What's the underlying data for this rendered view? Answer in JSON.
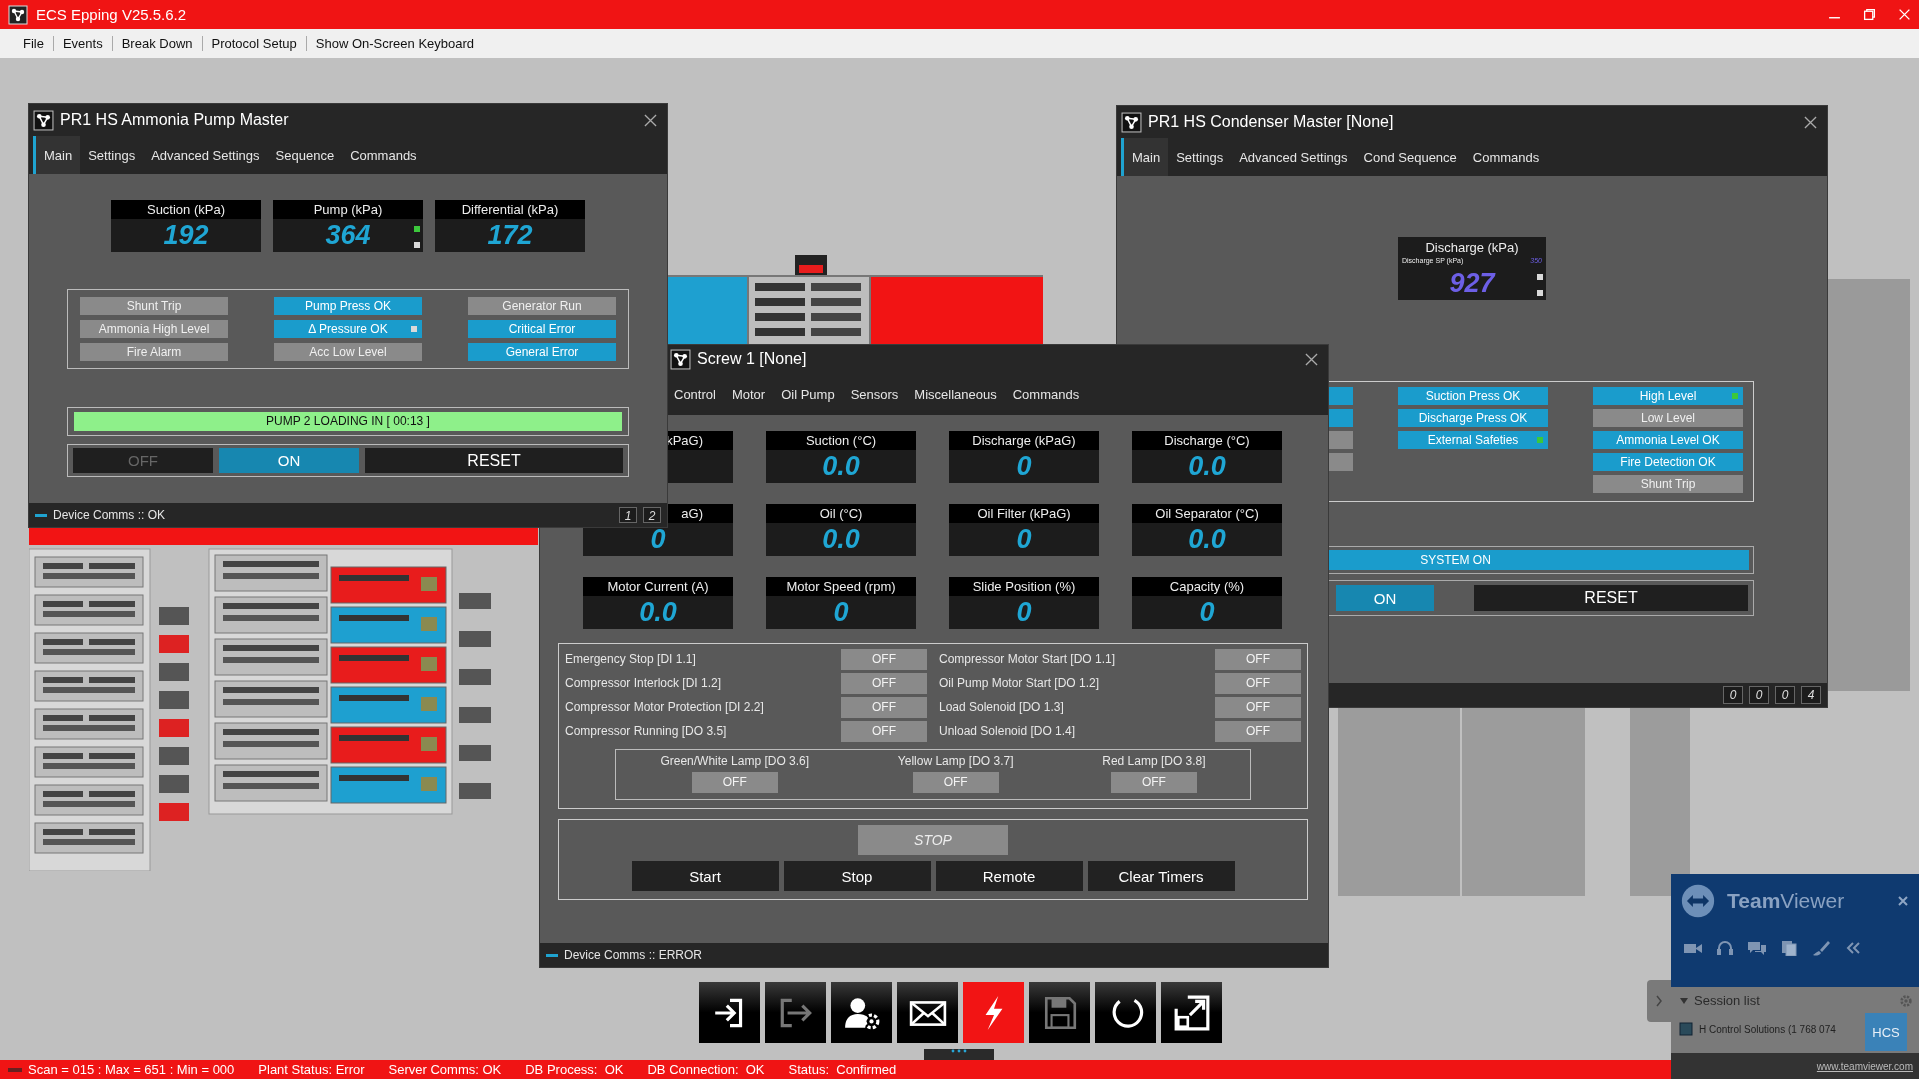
{
  "app": {
    "title": "ECS Epping V25.5.6.2"
  },
  "menu": [
    "File",
    "Events",
    "Break Down",
    "Protocol Setup",
    "Show On-Screen Keyboard"
  ],
  "pump_master": {
    "title": "PR1 HS Ammonia Pump Master",
    "tabs": [
      {
        "label": "Main",
        "selected": true
      },
      {
        "label": "Settings",
        "selected": false
      },
      {
        "label": "Advanced Settings",
        "selected": false
      },
      {
        "label": "Sequence",
        "selected": false
      },
      {
        "label": "Commands",
        "selected": false
      }
    ],
    "readings": [
      {
        "label": "Suction (kPa)",
        "value": "192"
      },
      {
        "label": "Pump (kPa)",
        "value": "364",
        "leds": [
          {
            "color": "#3cc83c"
          },
          {
            "color": "#d9d9d9"
          }
        ]
      },
      {
        "label": "Differential (kPa)",
        "value": "172"
      }
    ],
    "indicators": [
      {
        "label": "Shunt Trip",
        "on": false
      },
      {
        "label": "Pump Press OK",
        "on": true
      },
      {
        "label": "Generator Run",
        "on": false
      },
      {
        "label": "Ammonia High Level",
        "on": false
      },
      {
        "label": "Δ Pressure OK",
        "on": true,
        "led": {
          "color": "#d9d9d9"
        }
      },
      {
        "label": "Critical Error",
        "on": true
      },
      {
        "label": "Fire Alarm",
        "on": false
      },
      {
        "label": "Acc Low Level",
        "on": false
      },
      {
        "label": "General Error",
        "on": true
      }
    ],
    "banner": "PUMP 2 LOADING IN [ 00:13 ]",
    "modes": [
      {
        "label": "OFF",
        "selected": false
      },
      {
        "label": "ON",
        "selected": true
      }
    ],
    "reset": "RESET",
    "comms": "Device Comms :: OK",
    "pages": [
      "1",
      "2"
    ]
  },
  "screw": {
    "title": "Screw 1 [None]",
    "tabs": [
      {
        "label": "Control",
        "selected": false
      },
      {
        "label": "Motor",
        "selected": false
      },
      {
        "label": "Oil Pump",
        "selected": false
      },
      {
        "label": "Sensors",
        "selected": false
      },
      {
        "label": "Miscellaneous",
        "selected": false
      },
      {
        "label": "Commands",
        "selected": false
      }
    ],
    "tiles": [
      {
        "kind": "cut",
        "label": "kPaG)"
      },
      {
        "kind": "full",
        "label": "Suction (°C)",
        "value": "0.0"
      },
      {
        "kind": "full",
        "label": "Discharge (kPaG)",
        "value": "0"
      },
      {
        "kind": "full",
        "label": "Discharge (°C)",
        "value": "0.0"
      },
      {
        "kind": "cut",
        "label": "aG)",
        "value": "0"
      },
      {
        "kind": "full",
        "label": "Oil (°C)",
        "value": "0.0"
      },
      {
        "kind": "full",
        "label": "Oil Filter (kPaG)",
        "value": "0"
      },
      {
        "kind": "full",
        "label": "Oil Separator (°C)",
        "value": "0.0"
      },
      {
        "kind": "full",
        "label": "Motor Current (A)",
        "value": "0.0"
      },
      {
        "kind": "full",
        "label": "Motor Speed (rpm)",
        "value": "0"
      },
      {
        "kind": "full",
        "label": "Slide Position (%)",
        "value": "0"
      },
      {
        "kind": "full",
        "label": "Capacity (%)",
        "value": "0"
      }
    ],
    "inputs": [
      {
        "label": "Emergency Stop [DI 1.1]",
        "value": "OFF"
      },
      {
        "label": "Compressor Interlock [DI 1.2]",
        "value": "OFF"
      },
      {
        "label": "Compressor Motor Protection [DI 2.2]",
        "value": "OFF"
      },
      {
        "label": "Compressor Running [DO 3.5]",
        "value": "OFF"
      }
    ],
    "outputs": [
      {
        "label": "Compressor Motor Start [DO 1.1]",
        "value": "OFF"
      },
      {
        "label": "Oil Pump Motor Start [DO 1.2]",
        "value": "OFF"
      },
      {
        "label": "Load Solenoid [DO 1.3]",
        "value": "OFF"
      },
      {
        "label": "Unload Solenoid [DO 1.4]",
        "value": "OFF"
      }
    ],
    "lamps": [
      {
        "label": "Green/White Lamp [DO 3.6]",
        "value": "OFF"
      },
      {
        "label": "Yellow Lamp [DO 3.7]",
        "value": "OFF"
      },
      {
        "label": "Red Lamp [DO 3.8]",
        "value": "OFF"
      }
    ],
    "state": "STOP",
    "commands": [
      "Start",
      "Stop",
      "Remote",
      "Clear Timers"
    ],
    "comms": "Device Comms :: ERROR"
  },
  "condenser": {
    "title": "PR1 HS Condenser Master [None]",
    "tabs": [
      {
        "label": "Main",
        "selected": true
      },
      {
        "label": "Settings",
        "selected": false
      },
      {
        "label": "Advanced Settings",
        "selected": false
      },
      {
        "label": "Cond Sequence",
        "selected": false
      },
      {
        "label": "Commands",
        "selected": false
      }
    ],
    "discharge": {
      "label": "Discharge (kPa)",
      "setpoint_label": "Discharge SP (kPa)",
      "setpoint_value": "350",
      "value": "927",
      "leds": [
        {
          "color": "#d9d9d9"
        },
        {
          "color": "#d9d9d9"
        }
      ]
    },
    "hidden_indicators": [
      {
        "on": true
      },
      {
        "on": true
      },
      {
        "on": false
      },
      {
        "on": false
      }
    ],
    "indicators_middle": [
      {
        "label": "Suction Press OK",
        "on": true
      },
      {
        "label": "Discharge Press OK",
        "on": true
      },
      {
        "label": "External Safeties",
        "on": true,
        "led": {
          "color": "#3cc83c"
        }
      }
    ],
    "indicators_right": [
      {
        "label": "High Level",
        "on": true,
        "led": {
          "color": "#3cc83c"
        }
      },
      {
        "label": "Low Level",
        "on": false
      },
      {
        "label": "Ammonia Level OK",
        "on": true
      },
      {
        "label": "Fire Detection OK",
        "on": true
      },
      {
        "label": "Shunt Trip",
        "on": false
      }
    ],
    "system": "SYSTEM ON",
    "modes": [
      {
        "label": "ON",
        "selected": true
      }
    ],
    "reset": "RESET",
    "counters": [
      "0",
      "0",
      "0",
      "4"
    ]
  },
  "toolbar": [
    {
      "kind": "login",
      "disabled": false
    },
    {
      "kind": "logout",
      "disabled": true
    },
    {
      "kind": "user-settings",
      "disabled": false
    },
    {
      "kind": "mail",
      "disabled": false
    },
    {
      "kind": "alarm",
      "disabled": false
    },
    {
      "kind": "save",
      "disabled": true
    },
    {
      "kind": "refresh",
      "disabled": false
    },
    {
      "kind": "expand",
      "disabled": false
    }
  ],
  "status_bar": [
    "Scan = 015 : Max = 651 : Min = 000",
    "Plant Status: Error",
    "Server Comms: OK",
    "DB Process:  OK",
    "DB Connection:  OK",
    "Status:  Confirmed"
  ],
  "teamviewer": {
    "title": "**Team**Viewer",
    "session_list": "Session list",
    "session": "H Control Solutions (1 768 074",
    "logo": "HCS",
    "url": "www.teamviewer.com"
  }
}
